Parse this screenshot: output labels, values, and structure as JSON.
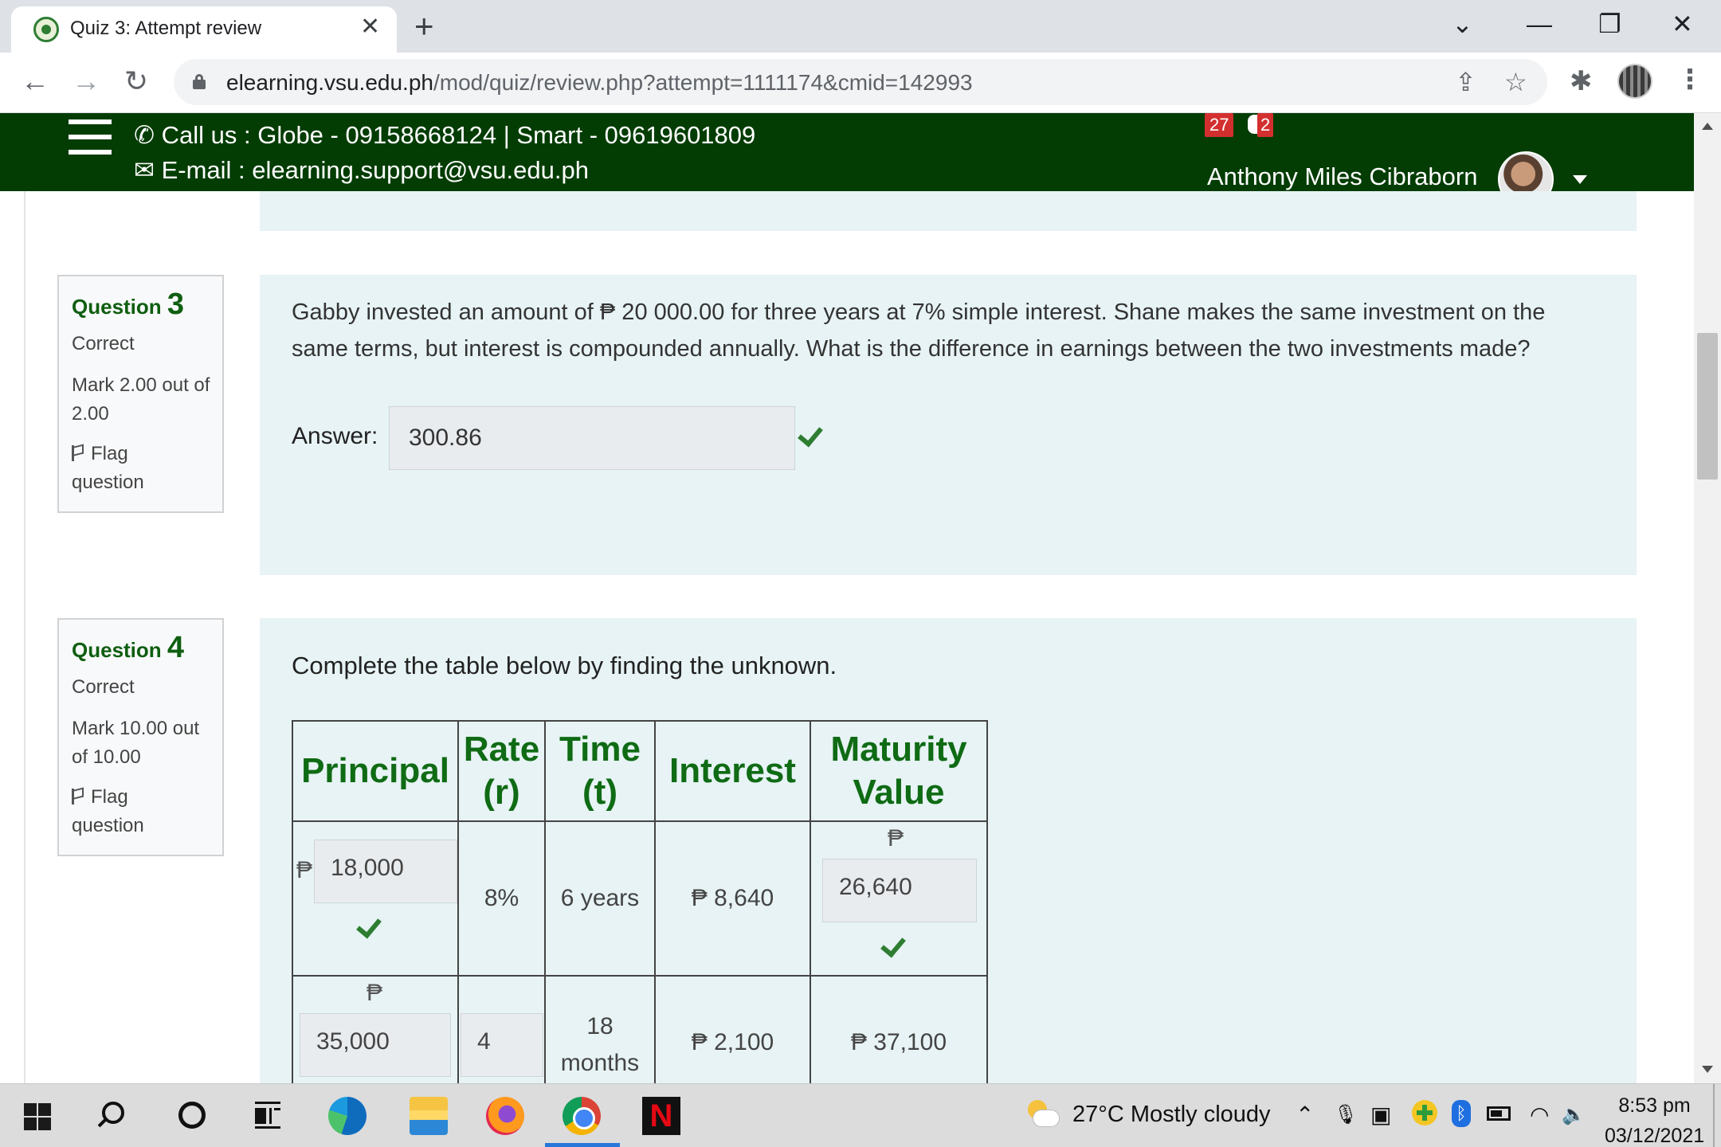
{
  "browser": {
    "tab_title": "Quiz 3: Attempt review",
    "tab_close": "✕",
    "new_tab": "+",
    "url_host": "elearning.vsu.edu.ph",
    "url_path": "/mod/quiz/review.php?attempt=1111174&cmid=142993",
    "back": "←",
    "forward": "→",
    "reload": "↻",
    "share": "⇪",
    "star": "☆",
    "extensions": "✱",
    "menu": "⋮",
    "tab_search": "⌄",
    "minimize": "—",
    "restore": "❐",
    "close": "✕"
  },
  "site": {
    "phone_line": "Call us : Globe - 09158668124 | Smart - 09619601809",
    "email_line": "E-mail : elearning.support@vsu.edu.ph",
    "phone_icon": "✆",
    "email_icon": "✉",
    "notification_count": "27",
    "message_count": "2",
    "user_name": "Anthony Miles Cibraborn"
  },
  "questions": [
    {
      "label": "Question",
      "number": "3",
      "state": "Correct",
      "grade": "Mark 2.00 out of 2.00",
      "flag": "Flag question",
      "text": "Gabby invested an amount of ₱ 20 000.00 for three years at 7% simple interest. Shane makes the same investment on the same terms, but interest is compounded annually. What is the difference in earnings between the two investments made?",
      "answer_label": "Answer:",
      "answer_value": "300.86"
    },
    {
      "label": "Question",
      "number": "4",
      "state": "Correct",
      "grade": "Mark 10.00 out of 10.00",
      "flag": "Flag question",
      "instruction": "Complete the table below by finding the unknown.",
      "table": {
        "headers": [
          "Principal",
          "Rate (r)",
          "Time (t)",
          "Interest",
          "Maturity Value"
        ],
        "rows": [
          {
            "principal_symbol": "₱",
            "principal": "18,000",
            "rate": "8%",
            "time": "6 years",
            "interest": "₱ 8,640",
            "maturity_symbol": "₱",
            "maturity": "26,640"
          },
          {
            "principal_symbol": "₱",
            "principal": "35,000",
            "rate": "4",
            "time": "18 months",
            "interest": "₱ 2,100",
            "maturity": "₱ 37,100"
          }
        ]
      }
    }
  ],
  "taskbar": {
    "weather": "27°C  Mostly cloudy",
    "netflix_letter": "N",
    "bluetooth": "ᛒ",
    "tray_up": "⌃",
    "tray_mic": "🎙",
    "tray_chat": "▣",
    "tray_wifi": "◠",
    "tray_speaker": "🔈",
    "time": "8:53 pm",
    "date": "03/12/2021"
  }
}
